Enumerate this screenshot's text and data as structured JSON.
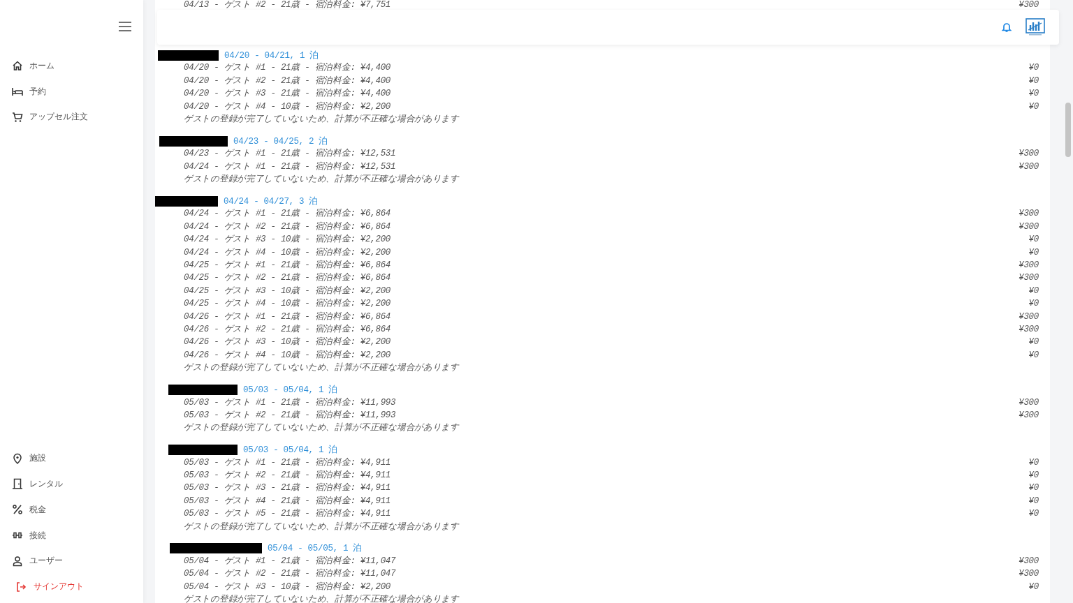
{
  "sidebar": {
    "top_items": [
      {
        "label": "ホーム"
      },
      {
        "label": "予約"
      },
      {
        "label": "アップセル注文"
      }
    ],
    "bottom_items": [
      {
        "label": "施設"
      },
      {
        "label": "レンタル"
      },
      {
        "label": "税金"
      },
      {
        "label": "接続"
      },
      {
        "label": "ユーザー"
      }
    ],
    "sign_out": "サインアウト"
  },
  "partial_row": {
    "text": "04/13 - ゲスト #2 - 21歳 - 宿泊料金: ¥7,751",
    "amount": "¥300"
  },
  "groups": [
    {
      "stay": "04/20 - 04/21, 1 泊",
      "rows": [
        {
          "text": "04/20 - ゲスト #1 - 21歳 - 宿泊料金: ¥4,400",
          "amount": "¥0"
        },
        {
          "text": "04/20 - ゲスト #2 - 21歳 - 宿泊料金: ¥4,400",
          "amount": "¥0"
        },
        {
          "text": "04/20 - ゲスト #3 - 21歳 - 宿泊料金: ¥4,400",
          "amount": "¥0"
        },
        {
          "text": "04/20 - ゲスト #4 - 10歳 - 宿泊料金: ¥2,200",
          "amount": "¥0"
        }
      ],
      "note": "ゲストの登録が完了していないため、計算が不正確な場合があります"
    },
    {
      "stay": "04/23 - 04/25, 2 泊",
      "rows": [
        {
          "text": "04/23 - ゲスト #1 - 21歳 - 宿泊料金: ¥12,531",
          "amount": "¥300"
        },
        {
          "text": "04/24 - ゲスト #1 - 21歳 - 宿泊料金: ¥12,531",
          "amount": "¥300"
        }
      ],
      "note": "ゲストの登録が完了していないため、計算が不正確な場合があります"
    },
    {
      "stay": "04/24 - 04/27, 3 泊",
      "rows": [
        {
          "text": "04/24 - ゲスト #1 - 21歳 - 宿泊料金: ¥6,864",
          "amount": "¥300"
        },
        {
          "text": "04/24 - ゲスト #2 - 21歳 - 宿泊料金: ¥6,864",
          "amount": "¥300"
        },
        {
          "text": "04/24 - ゲスト #3 - 10歳 - 宿泊料金: ¥2,200",
          "amount": "¥0"
        },
        {
          "text": "04/24 - ゲスト #4 - 10歳 - 宿泊料金: ¥2,200",
          "amount": "¥0"
        },
        {
          "text": "04/25 - ゲスト #1 - 21歳 - 宿泊料金: ¥6,864",
          "amount": "¥300"
        },
        {
          "text": "04/25 - ゲスト #2 - 21歳 - 宿泊料金: ¥6,864",
          "amount": "¥300"
        },
        {
          "text": "04/25 - ゲスト #3 - 10歳 - 宿泊料金: ¥2,200",
          "amount": "¥0"
        },
        {
          "text": "04/25 - ゲスト #4 - 10歳 - 宿泊料金: ¥2,200",
          "amount": "¥0"
        },
        {
          "text": "04/26 - ゲスト #1 - 21歳 - 宿泊料金: ¥6,864",
          "amount": "¥300"
        },
        {
          "text": "04/26 - ゲスト #2 - 21歳 - 宿泊料金: ¥6,864",
          "amount": "¥300"
        },
        {
          "text": "04/26 - ゲスト #3 - 10歳 - 宿泊料金: ¥2,200",
          "amount": "¥0"
        },
        {
          "text": "04/26 - ゲスト #4 - 10歳 - 宿泊料金: ¥2,200",
          "amount": "¥0"
        }
      ],
      "note": "ゲストの登録が完了していないため、計算が不正確な場合があります"
    },
    {
      "stay": "05/03 - 05/04, 1 泊",
      "rows": [
        {
          "text": "05/03 - ゲスト #1 - 21歳 - 宿泊料金: ¥11,993",
          "amount": "¥300"
        },
        {
          "text": "05/03 - ゲスト #2 - 21歳 - 宿泊料金: ¥11,993",
          "amount": "¥300"
        }
      ],
      "note": "ゲストの登録が完了していないため、計算が不正確な場合があります"
    },
    {
      "stay": "05/03 - 05/04, 1 泊",
      "rows": [
        {
          "text": "05/03 - ゲスト #1 - 21歳 - 宿泊料金: ¥4,911",
          "amount": "¥0"
        },
        {
          "text": "05/03 - ゲスト #2 - 21歳 - 宿泊料金: ¥4,911",
          "amount": "¥0"
        },
        {
          "text": "05/03 - ゲスト #3 - 21歳 - 宿泊料金: ¥4,911",
          "amount": "¥0"
        },
        {
          "text": "05/03 - ゲスト #4 - 21歳 - 宿泊料金: ¥4,911",
          "amount": "¥0"
        },
        {
          "text": "05/03 - ゲスト #5 - 21歳 - 宿泊料金: ¥4,911",
          "amount": "¥0"
        }
      ],
      "note": "ゲストの登録が完了していないため、計算が不正確な場合があります"
    },
    {
      "stay": "05/04 - 05/05, 1 泊",
      "rows": [
        {
          "text": "05/04 - ゲスト #1 - 21歳 - 宿泊料金: ¥11,047",
          "amount": "¥300"
        },
        {
          "text": "05/04 - ゲスト #2 - 21歳 - 宿泊料金: ¥11,047",
          "amount": "¥300"
        },
        {
          "text": "05/04 - ゲスト #3 - 10歳 - 宿泊料金: ¥2,200",
          "amount": "¥0"
        }
      ],
      "note": "ゲストの登録が完了していないため、計算が不正確な場合があります"
    }
  ]
}
